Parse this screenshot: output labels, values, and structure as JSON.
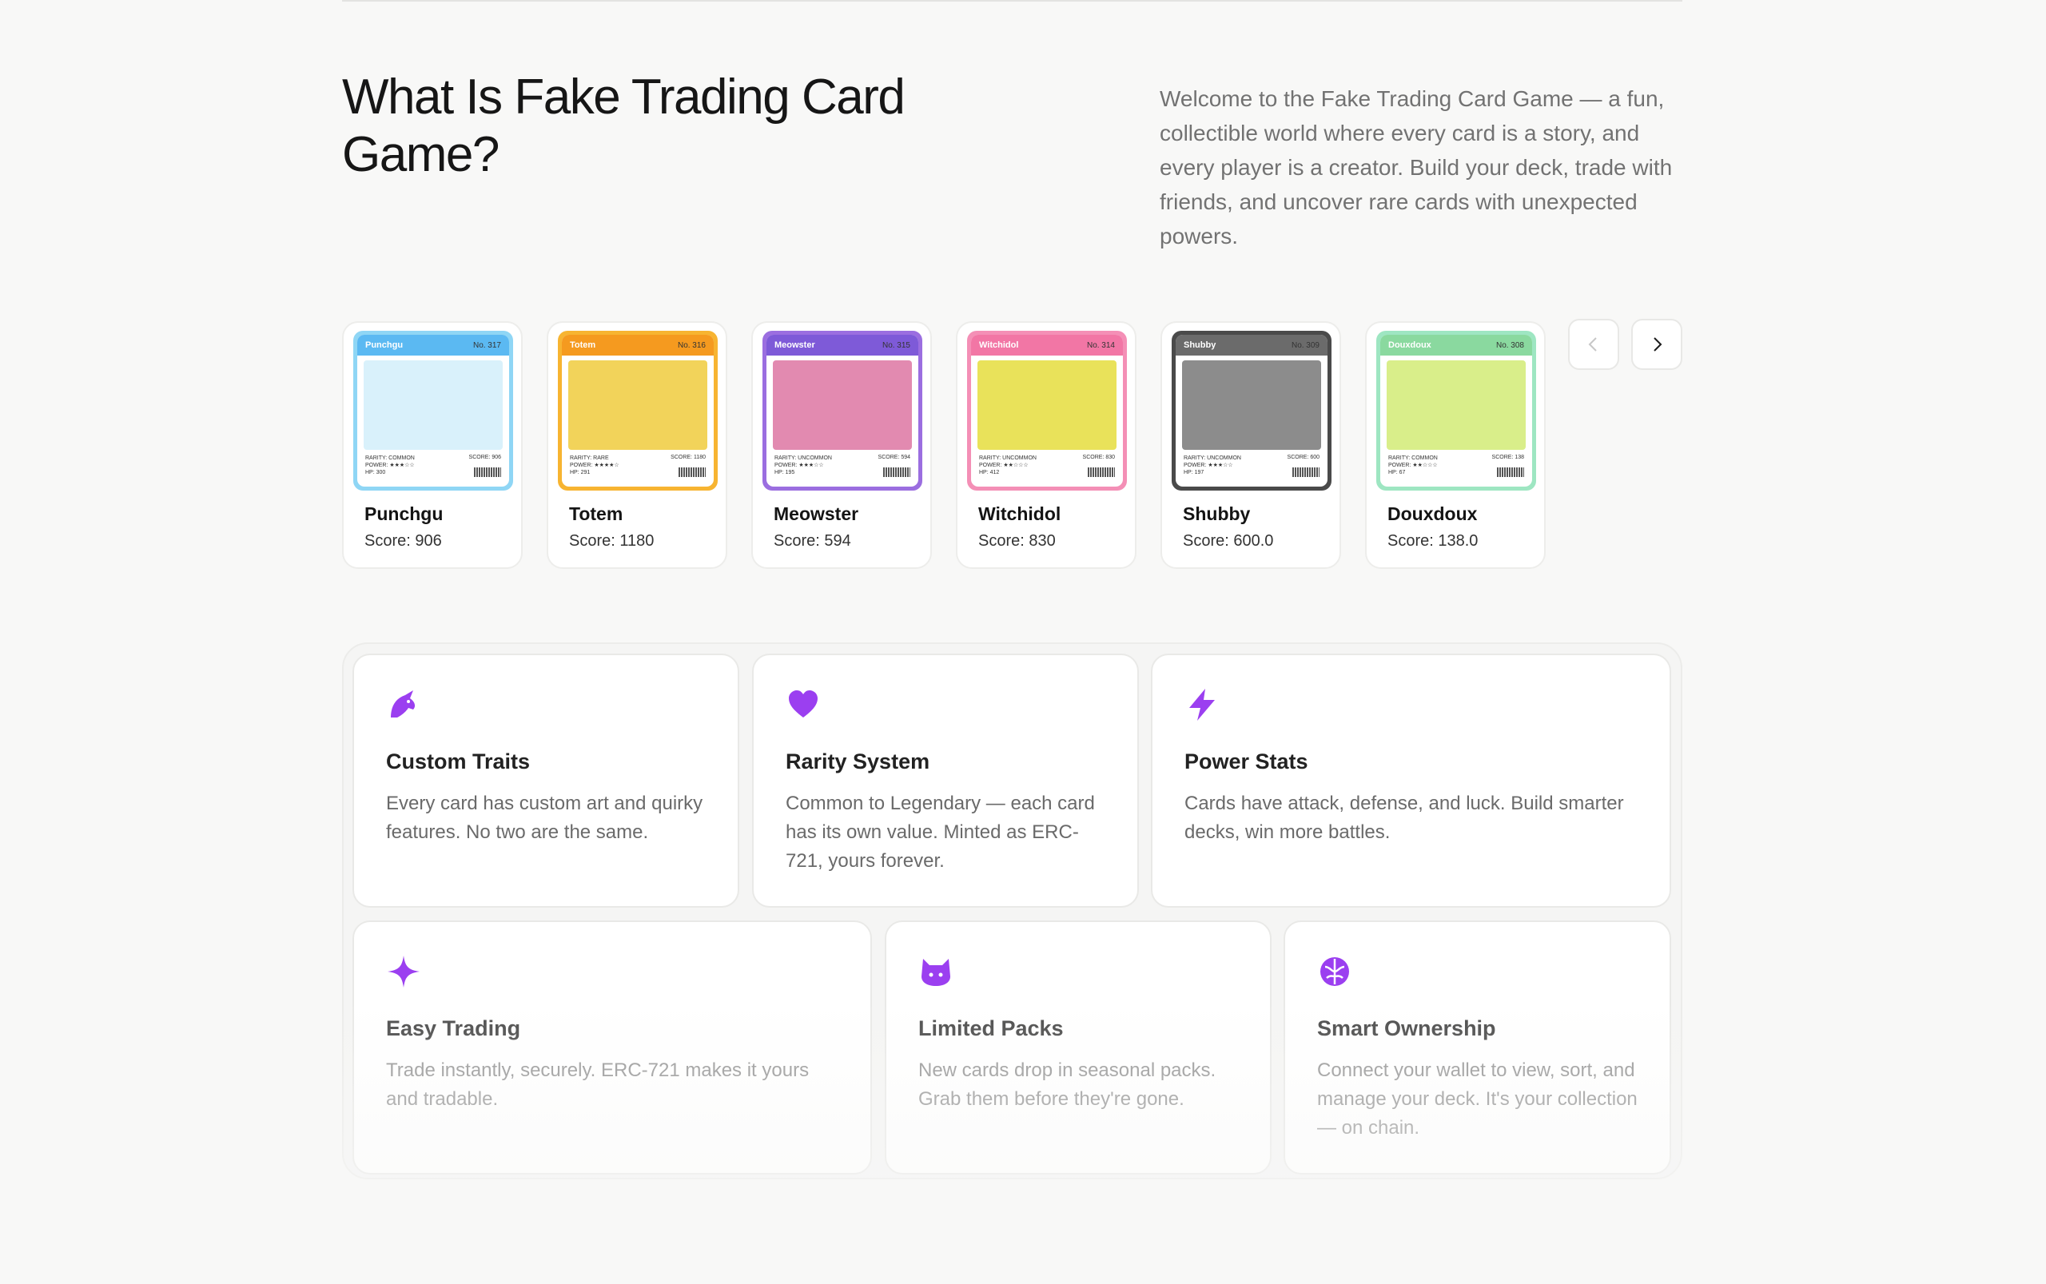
{
  "section": {
    "title": "What Is Fake Trading Card Game?",
    "intro": "Welcome to the Fake Trading Card Game — a fun, collectible world where every card is a story, and every player is a creator. Build your deck, trade with friends, and uncover rare cards with unexpected powers."
  },
  "cards": [
    {
      "name": "Punchgu",
      "score": "Score: 906",
      "art_name": "Punchgu",
      "art_no": "No. 317",
      "rarity": "RARITY: COMMON",
      "power": "POWER: ★★★☆☆",
      "hp": "HP: 300",
      "art_score": "SCORE: 906",
      "frame_color": "#8fd6f5",
      "head_color": "#5bb9f2",
      "pic_color": "#d9f1fb"
    },
    {
      "name": "Totem",
      "score": "Score: 1180",
      "art_name": "Totem",
      "art_no": "No. 316",
      "rarity": "RARITY: RARE",
      "power": "POWER: ★★★★☆",
      "hp": "HP: 291",
      "art_score": "SCORE: 1180",
      "frame_color": "#f7b431",
      "head_color": "#f59a1f",
      "pic_color": "#f2d35a"
    },
    {
      "name": "Meowster",
      "score": "Score: 594",
      "art_name": "Meowster",
      "art_no": "No. 315",
      "rarity": "RARITY: UNCOMMON",
      "power": "POWER: ★★★☆☆",
      "hp": "HP: 195",
      "art_score": "SCORE: 594",
      "frame_color": "#9b6ee0",
      "head_color": "#7e5ad8",
      "pic_color": "#e28ab0"
    },
    {
      "name": "Witchidol",
      "score": "Score: 830",
      "art_name": "Witchidol",
      "art_no": "No. 314",
      "rarity": "RARITY: UNCOMMON",
      "power": "POWER: ★★☆☆☆",
      "hp": "HP: 412",
      "art_score": "SCORE: 830",
      "frame_color": "#f48fb6",
      "head_color": "#f276a5",
      "pic_color": "#e9e25a"
    },
    {
      "name": "Shubby",
      "score": "Score: 600.0",
      "art_name": "Shubby",
      "art_no": "No. 309",
      "rarity": "RARITY: UNCOMMON",
      "power": "POWER: ★★★☆☆",
      "hp": "HP: 197",
      "art_score": "SCORE: 600",
      "frame_color": "#4a4a4a",
      "head_color": "#6b6b6b",
      "pic_color": "#8c8c8c"
    },
    {
      "name": "Douxdoux",
      "score": "Score: 138.0",
      "art_name": "Douxdoux",
      "art_no": "No. 308",
      "rarity": "RARITY: COMMON",
      "power": "POWER: ★★☆☆☆",
      "hp": "HP: 67",
      "art_score": "SCORE: 138",
      "frame_color": "#9ee6c2",
      "head_color": "#8ad99f",
      "pic_color": "#d9ee8a"
    }
  ],
  "carousel": {
    "prev_icon": "chevron-left-icon",
    "next_icon": "chevron-right-icon"
  },
  "features": [
    {
      "title": "Custom Traits",
      "desc": "Every card has custom art and quirky features. No two are the same.",
      "icon": "unicorn-icon"
    },
    {
      "title": "Rarity System",
      "desc": "Common to Legendary — each card has its own value. Minted as ERC-721, yours forever.",
      "icon": "heart-icon"
    },
    {
      "title": "Power Stats",
      "desc": "Cards have attack, defense, and luck. Build smarter decks, win more battles.",
      "icon": "lightning-icon"
    },
    {
      "title": "Easy Trading",
      "desc": "Trade instantly, securely. ERC-721 makes it yours and tradable.",
      "icon": "sparkle-icon"
    },
    {
      "title": "Limited Packs",
      "desc": "New cards drop in seasonal packs. Grab them before they're gone.",
      "icon": "cat-icon"
    },
    {
      "title": "Smart Ownership",
      "desc": "Connect your wallet to view, sort, and manage your deck. It's your collection — on chain.",
      "icon": "brain-icon"
    }
  ],
  "colors": {
    "accent": "#9b3ff0",
    "background": "#f8f8f7"
  }
}
